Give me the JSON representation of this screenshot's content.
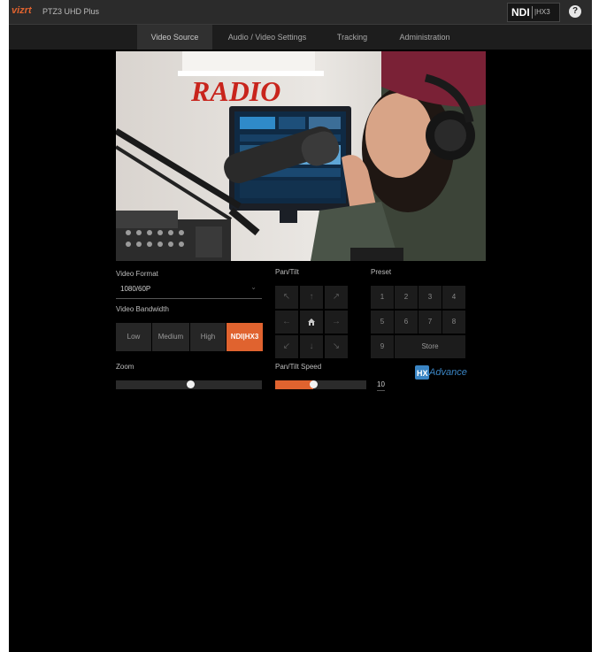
{
  "header": {
    "logo": "vizrt",
    "model": "PTZ3 UHD Plus",
    "ndi_badge": {
      "text": "NDI",
      "suffix": "|HX3"
    },
    "help_label": "?"
  },
  "tabs": [
    {
      "label": "Video Source",
      "active": true
    },
    {
      "label": "Audio / Video Settings",
      "active": false
    },
    {
      "label": "Tracking",
      "active": false
    },
    {
      "label": "Administration",
      "active": false
    }
  ],
  "preview": {
    "sign_text": "RADIO"
  },
  "video_format": {
    "label": "Video Format",
    "value": "1080/60P"
  },
  "video_bandwidth": {
    "label": "Video Bandwidth",
    "options": [
      "Low",
      "Medium",
      "High",
      "NDI|HX3"
    ],
    "selected": "NDI|HX3"
  },
  "zoom": {
    "label": "Zoom",
    "level": 0.51
  },
  "pantilt": {
    "label": "Pan/Tilt",
    "buttons": [
      "↖",
      "↑",
      "↗",
      "←",
      "home",
      "→",
      "↙",
      "↓",
      "↘"
    ]
  },
  "pantilt_speed": {
    "label": "Pan/Tilt Speed",
    "level": 0.42,
    "value": "10"
  },
  "preset": {
    "label": "Preset",
    "numbers": [
      "1",
      "2",
      "3",
      "4",
      "5",
      "6",
      "7",
      "8",
      "9"
    ],
    "store_label": "Store"
  },
  "hx_logo": {
    "text": "Advance",
    "mark": "HX"
  },
  "colors": {
    "accent": "#e0632f",
    "background": "#000000",
    "topbar": "#2b2b2b",
    "link_blue": "#3a85c4"
  }
}
